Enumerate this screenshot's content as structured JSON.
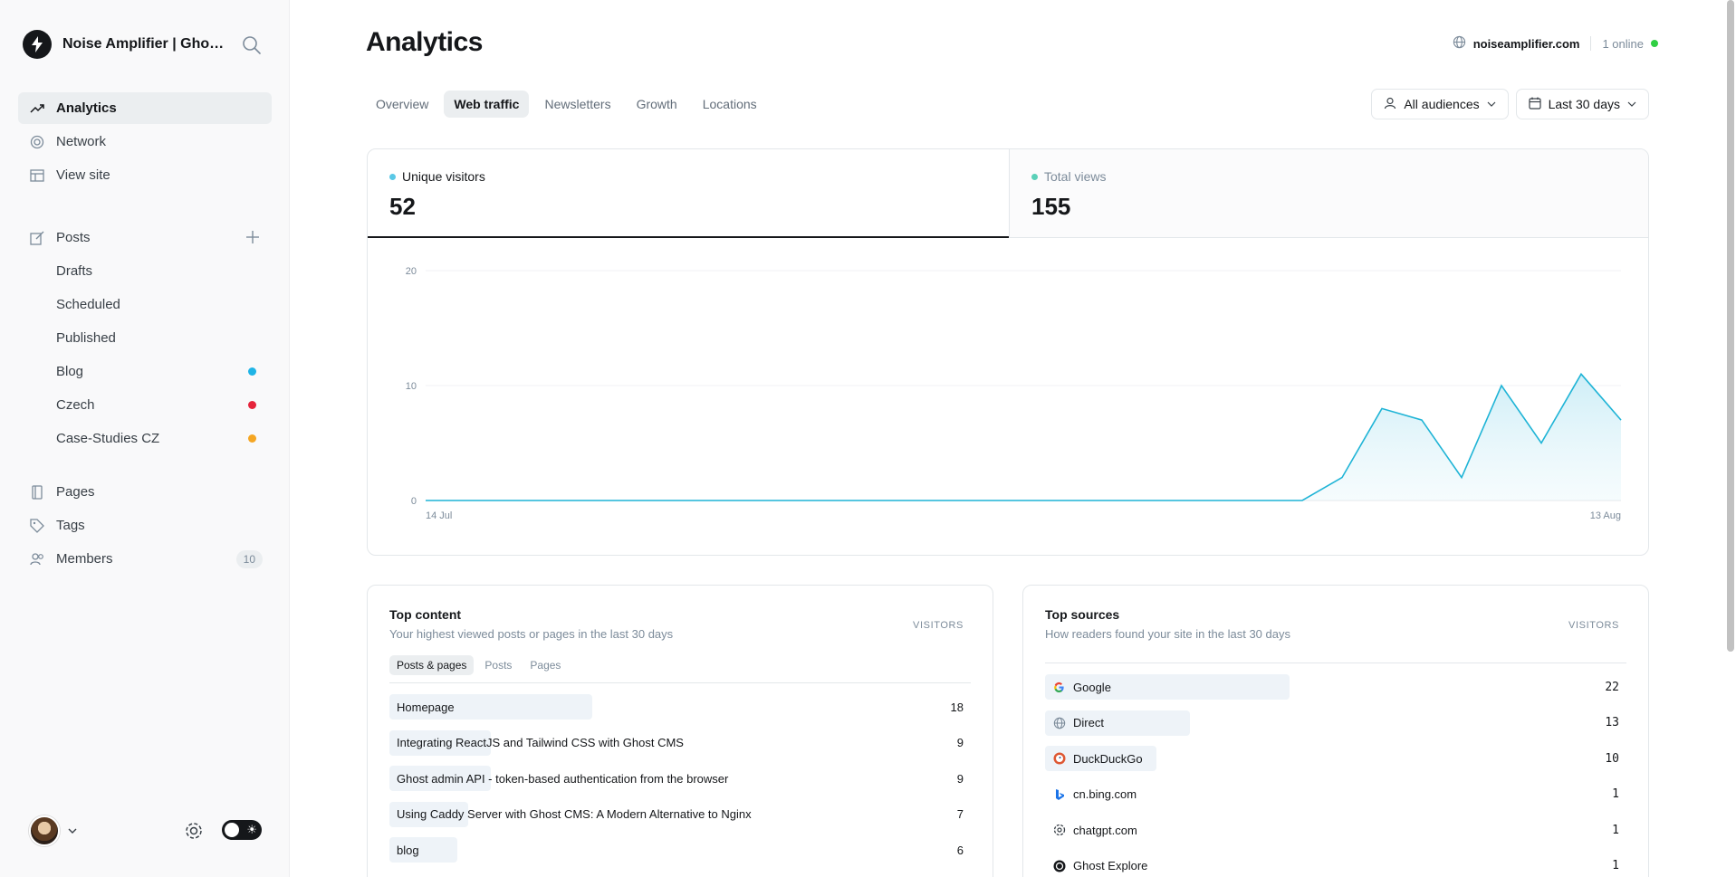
{
  "brand": {
    "name": "Noise Amplifier | Ghost..."
  },
  "sidebar": {
    "primary": [
      {
        "label": "Analytics",
        "icon": "trend-icon",
        "active": true
      },
      {
        "label": "Network",
        "icon": "network-icon"
      },
      {
        "label": "View site",
        "icon": "layout-icon"
      }
    ],
    "posts": {
      "label": "Posts"
    },
    "post_items": [
      {
        "label": "Drafts"
      },
      {
        "label": "Scheduled"
      },
      {
        "label": "Published"
      },
      {
        "label": "Blog",
        "dot": "#1fb4e6"
      },
      {
        "label": "Czech",
        "dot": "#e5243b"
      },
      {
        "label": "Case-Studies CZ",
        "dot": "#f5a623"
      }
    ],
    "secondary": [
      {
        "label": "Pages",
        "icon": "page-icon"
      },
      {
        "label": "Tags",
        "icon": "tag-icon"
      },
      {
        "label": "Members",
        "icon": "members-icon",
        "badge": "10"
      }
    ]
  },
  "header": {
    "title": "Analytics",
    "domain": "noiseamplifier.com",
    "online": "1 online"
  },
  "tabs": [
    "Overview",
    "Web traffic",
    "Newsletters",
    "Growth",
    "Locations"
  ],
  "active_tab": "Web traffic",
  "filters": {
    "audience": "All audiences",
    "range": "Last 30 days"
  },
  "kpis": [
    {
      "label": "Unique visitors",
      "value": "52",
      "color": "#5ac8e6"
    },
    {
      "label": "Total views",
      "value": "155",
      "color": "#5ad0b8"
    }
  ],
  "chart_data": {
    "type": "area",
    "x_start_label": "14 Jul",
    "x_end_label": "13 Aug",
    "y_ticks": [
      "20",
      "10",
      "0"
    ],
    "ylim": [
      0,
      20
    ],
    "values": [
      0,
      0,
      0,
      0,
      0,
      0,
      0,
      0,
      0,
      0,
      0,
      0,
      0,
      0,
      0,
      0,
      0,
      0,
      0,
      0,
      0,
      0,
      0,
      2,
      8,
      7,
      2,
      10,
      5,
      11,
      7
    ],
    "color": "#1fb4d6",
    "grid": true
  },
  "top_content": {
    "title": "Top content",
    "subtitle": "Your highest viewed posts or pages in the last 30 days",
    "column": "VISITORS",
    "subtabs": [
      "Posts & pages",
      "Posts",
      "Pages"
    ],
    "rows": [
      {
        "label": "Homepage",
        "value": 18
      },
      {
        "label": "Integrating ReactJS and Tailwind CSS with Ghost CMS",
        "value": 9
      },
      {
        "label": "Ghost admin API - token-based authentication from the browser",
        "value": 9
      },
      {
        "label": "Using Caddy Server with Ghost CMS: A Modern Alternative to Nginx",
        "value": 7
      },
      {
        "label": "blog",
        "value": 6
      }
    ]
  },
  "top_sources": {
    "title": "Top sources",
    "subtitle": "How readers found your site in the last 30 days",
    "column": "VISITORS",
    "rows": [
      {
        "label": "Google",
        "value": 22,
        "icon": "google-icon"
      },
      {
        "label": "Direct",
        "value": 13,
        "icon": "globe-icon"
      },
      {
        "label": "DuckDuckGo",
        "value": 10,
        "icon": "duckduckgo-icon"
      },
      {
        "label": "cn.bing.com",
        "value": 1,
        "icon": "bing-icon"
      },
      {
        "label": "chatgpt.com",
        "value": 1,
        "icon": "chatgpt-icon"
      },
      {
        "label": "Ghost Explore",
        "value": 1,
        "icon": "ghost-icon"
      }
    ]
  }
}
